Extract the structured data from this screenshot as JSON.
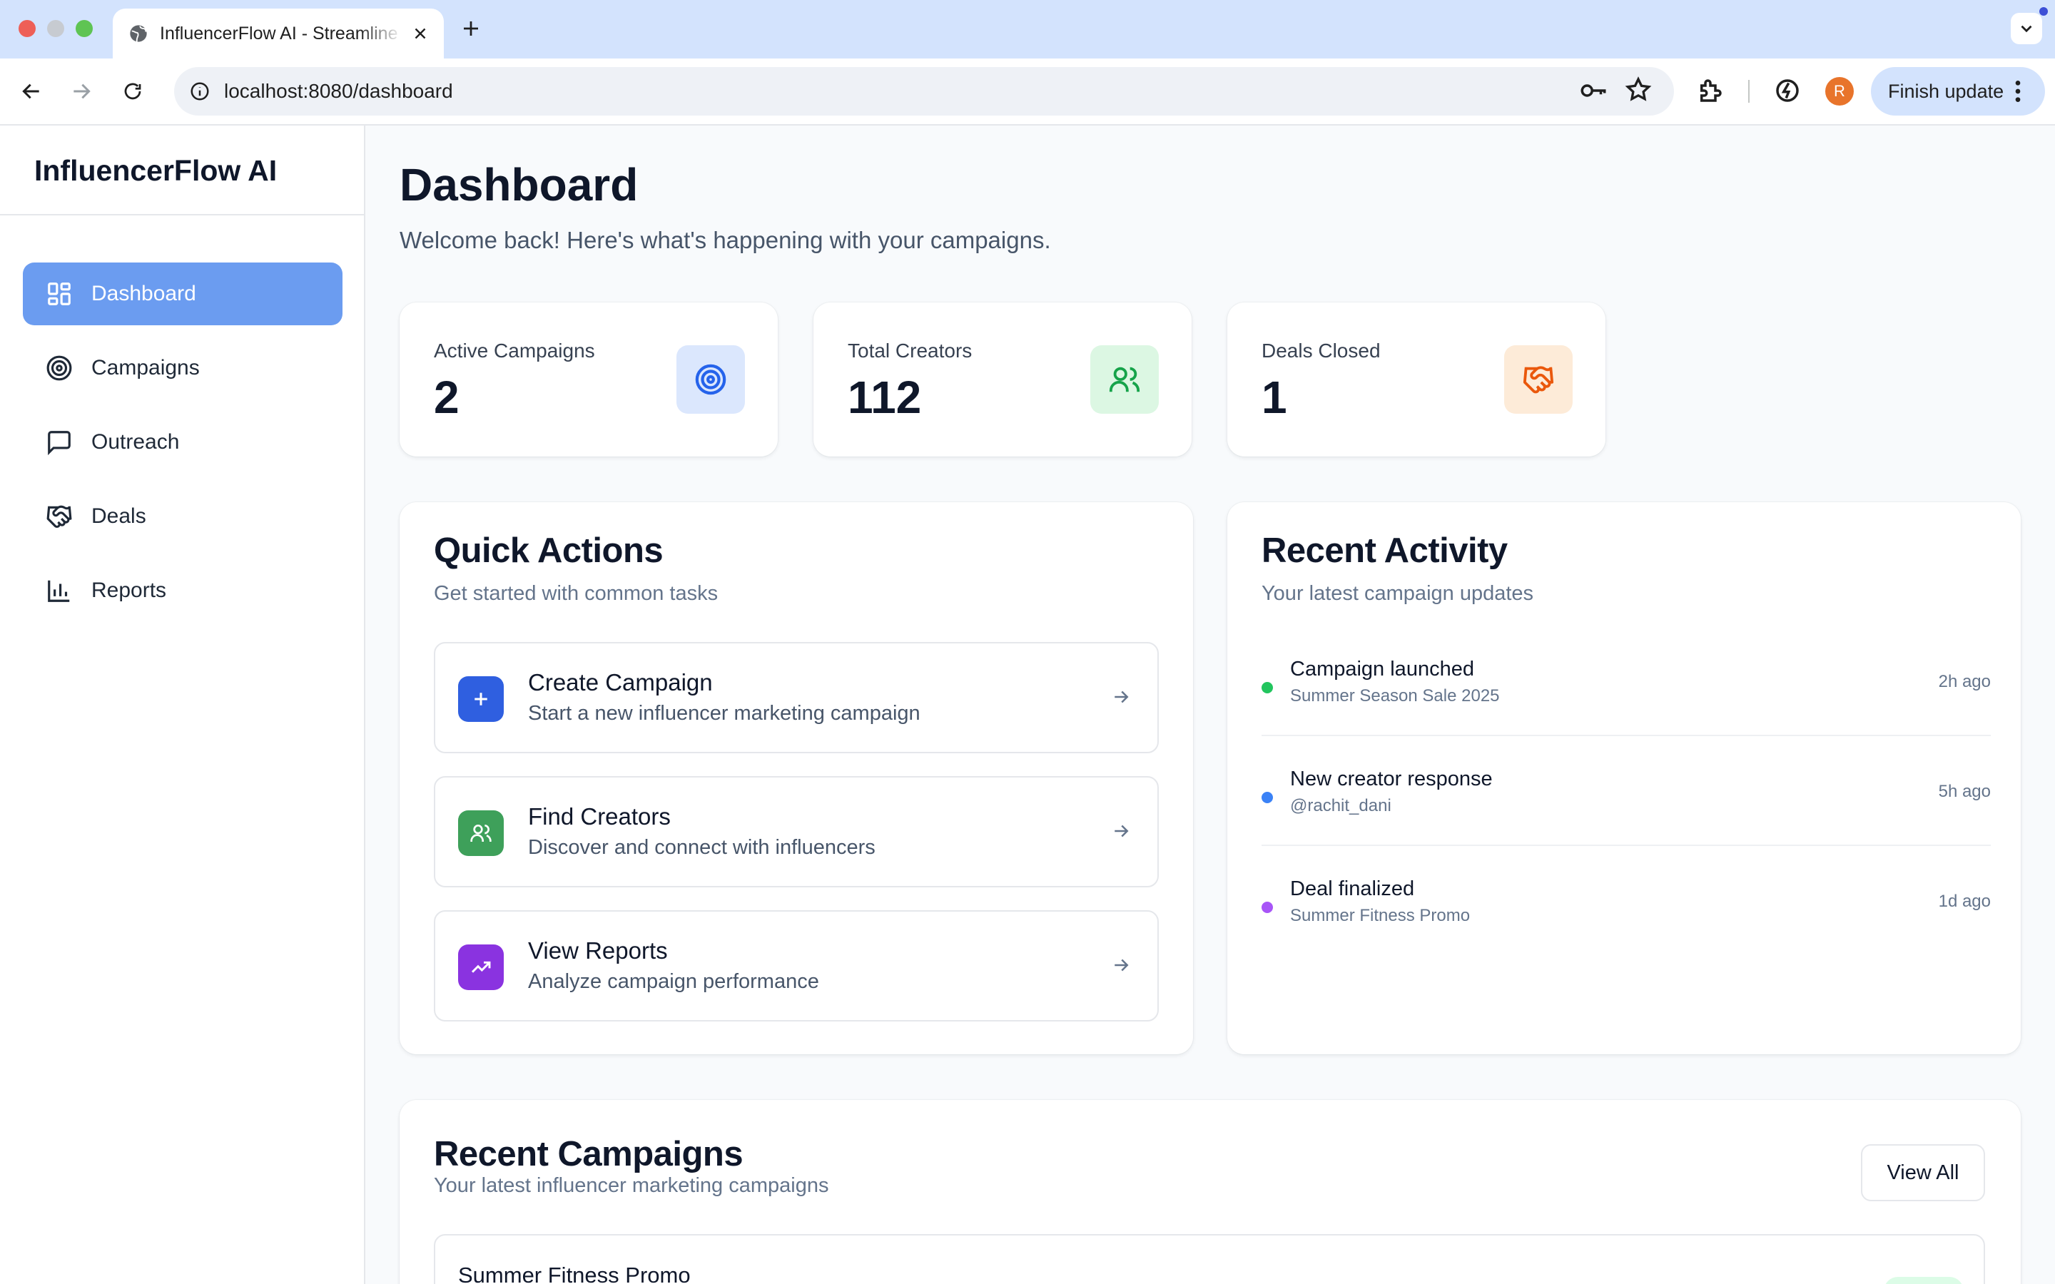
{
  "browser": {
    "tab_title": "InfluencerFlow AI - Streamline",
    "url": "localhost:8080/dashboard",
    "profile_initial": "R",
    "finish_update_label": "Finish update"
  },
  "sidebar": {
    "brand": "InfluencerFlow AI",
    "items": [
      {
        "label": "Dashboard",
        "icon": "layout-grid-icon",
        "active": true
      },
      {
        "label": "Campaigns",
        "icon": "target-icon",
        "active": false
      },
      {
        "label": "Outreach",
        "icon": "message-square-icon",
        "active": false
      },
      {
        "label": "Deals",
        "icon": "handshake-icon",
        "active": false
      },
      {
        "label": "Reports",
        "icon": "bar-chart-icon",
        "active": false
      }
    ]
  },
  "header": {
    "title": "Dashboard",
    "subtitle": "Welcome back! Here's what's happening with your campaigns."
  },
  "stats": [
    {
      "label": "Active Campaigns",
      "value": "2",
      "icon": "target-icon",
      "color": "#2563eb",
      "bg": "#dbe7fd"
    },
    {
      "label": "Total Creators",
      "value": "112",
      "icon": "users-icon",
      "color": "#16a34a",
      "bg": "#dcf7e3"
    },
    {
      "label": "Deals Closed",
      "value": "1",
      "icon": "handshake-icon",
      "color": "#ea580c",
      "bg": "#fdebd8"
    }
  ],
  "quick_actions": {
    "title": "Quick Actions",
    "subtitle": "Get started with common tasks",
    "items": [
      {
        "title": "Create Campaign",
        "desc": "Start a new influencer marketing campaign",
        "icon": "plus-icon",
        "color": "#2f5fe0"
      },
      {
        "title": "Find Creators",
        "desc": "Discover and connect with influencers",
        "icon": "users-icon",
        "color": "#3ea05a"
      },
      {
        "title": "View Reports",
        "desc": "Analyze campaign performance",
        "icon": "trending-up-icon",
        "color": "#8a33e0"
      }
    ]
  },
  "recent_activity": {
    "title": "Recent Activity",
    "subtitle": "Your latest campaign updates",
    "items": [
      {
        "title": "Campaign launched",
        "sub": "Summer Season Sale 2025",
        "time": "2h ago",
        "color": "#22c55e"
      },
      {
        "title": "New creator response",
        "sub": "@rachit_dani",
        "time": "5h ago",
        "color": "#3b82f6"
      },
      {
        "title": "Deal finalized",
        "sub": "Summer Fitness Promo",
        "time": "1d ago",
        "color": "#a855f7"
      }
    ]
  },
  "recent_campaigns": {
    "title": "Recent Campaigns",
    "subtitle": "Your latest influencer marketing campaigns",
    "view_all_label": "View All",
    "items": [
      {
        "name": "Summer Fitness Promo"
      }
    ]
  }
}
